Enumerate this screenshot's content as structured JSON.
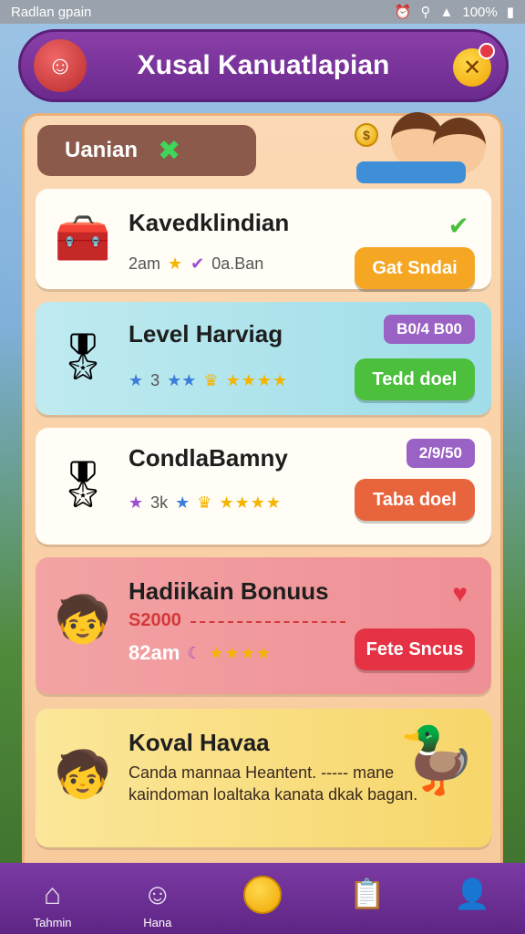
{
  "status_bar": {
    "carrier": "Radlan gpain",
    "battery": "100%"
  },
  "header": {
    "title": "Xusal Kanuatlapian"
  },
  "tab_chip": {
    "label": "Uanian"
  },
  "cards": [
    {
      "title": "Kavedklindian",
      "meta_left": "2am",
      "meta_right": "0a.Ban",
      "button": "Gat Sndai",
      "button_color": "#f5a623"
    },
    {
      "title": "Level Harviag",
      "meta_left": "3",
      "badge": "B0/4 B00",
      "button": "Tedd doel",
      "button_color": "#4cbf3c"
    },
    {
      "title": "CondlaBamny",
      "meta_left": "3k",
      "badge": "2/9/50",
      "button": "Taba doel",
      "button_color": "#e8643c"
    },
    {
      "title": "Hadiikain Bonuus",
      "amount": "S2000",
      "meta_left": "82am",
      "button": "Fete Sncus",
      "button_color": "#e53345"
    },
    {
      "title": "Koval Havaa",
      "description": "Canda mannaa Heantent. ----- mane kaindoman loaltaka kanata dkak bagan."
    }
  ],
  "bottom_nav": [
    {
      "label": "Tahmin",
      "icon": "home-icon"
    },
    {
      "label": "Hana",
      "icon": "smiley-icon"
    },
    {
      "label": "",
      "icon": "coin-icon"
    },
    {
      "label": "",
      "icon": "clipboard-icon"
    },
    {
      "label": "",
      "icon": "profile-icon"
    }
  ]
}
